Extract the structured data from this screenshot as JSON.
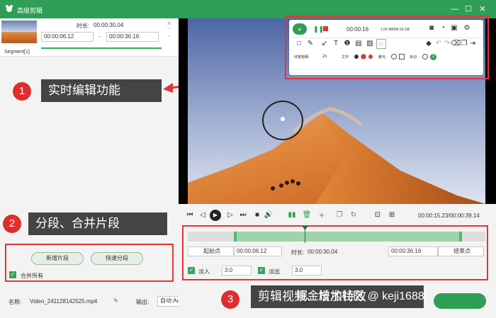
{
  "title": "高级剪辑",
  "window": {
    "min": "—",
    "max": "☐",
    "close": "✕"
  },
  "segment": {
    "duration_label": "时长:",
    "duration": "00:00:30.04",
    "start": "00:00:06.12",
    "end": "00:00:36.16",
    "dash": "-",
    "label": "Segment[1]"
  },
  "callouts": [
    {
      "num": "1",
      "text": "实时编辑功能"
    },
    {
      "num": "2",
      "text": "分段、合并片段"
    },
    {
      "num": "3",
      "text": "剪辑视频、增加特效"
    }
  ],
  "left_buttons": {
    "new_segment": "新增片段",
    "quick_split": "快速分段",
    "merge_all": "合并所有"
  },
  "bottom": {
    "name_label": "名称:",
    "filename": "Video_241128142525.mp4",
    "output_label": "输出:",
    "output_value": "自动:Auto"
  },
  "realtime": {
    "time": "00:00:16",
    "size": "1.06 MB/86.59 GB",
    "line_width_label": "线宽粗细:",
    "line_width_value": "2x",
    "text_label": "文字:",
    "focus_label": "聚光:",
    "mark_label": "标记:",
    "mark_num": "2"
  },
  "playback": {
    "time": "00:00:15.23/00:00:39.14"
  },
  "trim": {
    "start_btn": "起始点",
    "start": "00:00:06.12",
    "duration_label": "时长:",
    "duration": "00:00:30.04",
    "end": "00:00:36.16",
    "end_btn": "结束点",
    "fade_in_label": "淡入",
    "fade_in": "3.0",
    "fade_out_label": "淡出",
    "fade_out": "3.0"
  },
  "watermark": "掘金技术社区 @ keji1688",
  "colors": {
    "brand": "#2f9e56",
    "callout_red": "#e23434"
  }
}
